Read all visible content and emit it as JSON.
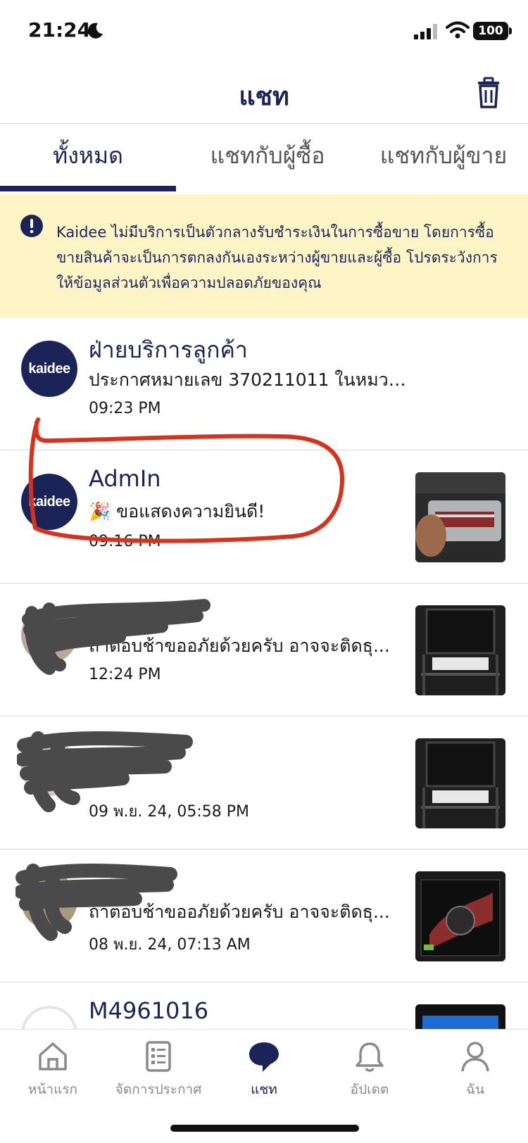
{
  "status_bar": {
    "time": "21:24",
    "battery": "100"
  },
  "header": {
    "title": "แชท"
  },
  "tabs": [
    {
      "label": "ทั้งหมด",
      "active": true
    },
    {
      "label": "แชทกับผู้ซื้อ",
      "active": false
    },
    {
      "label": "แชทกับผู้ขาย",
      "active": false
    }
  ],
  "notice": {
    "text": "Kaidee ไม่มีบริการเป็นตัวกลางรับชำระเงินในการซื้อขาย โดยการซื้อขายสินค้าจะเป็นการตกลงกันเองระหว่างผู้ขายและผู้ซื้อ โปรดระวังการให้ข้อมูลส่วนตัวเพื่อความปลอดภัยของคุณ"
  },
  "avatar_logo_text": "kaidee",
  "chats": [
    {
      "name": "ฝ่ายบริการลูกค้า",
      "message": "ประกาศหมายเลข 370211011 ในหมวด...",
      "time": "09:23 PM",
      "avatar": "kaidee-logo"
    },
    {
      "name": "AdmIn",
      "message": "🎉 ขอแสดงความยินดี!",
      "time": "09:16 PM",
      "avatar": "kaidee-logo",
      "thumbnail": "ram-package-photo"
    },
    {
      "name": "",
      "message": "ถ้าตอบช้าขออภัยด้วยครับ อาจจะติดธุ...",
      "time": "12:24 PM",
      "avatar": "user-photo",
      "thumbnail": "computer-desk-photo"
    },
    {
      "name": "",
      "message": "",
      "time": "09 พ.ย. 24, 05:58 PM",
      "avatar": "user-photo",
      "thumbnail": "computer-desk-photo"
    },
    {
      "name": "",
      "message": "ถ้าตอบช้าขออภัยด้วยครับ อาจจะติดธุ...",
      "time": "08 พ.ย. 24, 07:13 AM",
      "avatar": "user-photo",
      "thumbnail": "gigabyte-gpu-box-photo"
    },
    {
      "name": "M4961016",
      "message": "",
      "time": "",
      "avatar": "default-avatar",
      "thumbnail": "monitor-photo"
    }
  ],
  "bottom_nav": [
    {
      "label": "หน้าแรก",
      "icon": "home-icon",
      "active": false
    },
    {
      "label": "จัดการประกาศ",
      "icon": "listing-icon",
      "active": false
    },
    {
      "label": "แชท",
      "icon": "chat-icon",
      "active": true
    },
    {
      "label": "อัปเดต",
      "icon": "bell-icon",
      "active": false
    },
    {
      "label": "ฉัน",
      "icon": "profile-icon",
      "active": false
    }
  ],
  "colors": {
    "brand_navy": "#1b2459",
    "notice_bg": "#fdf5c6",
    "annotation_red": "#d8311c",
    "redaction_gray": "#4a4a4a"
  }
}
